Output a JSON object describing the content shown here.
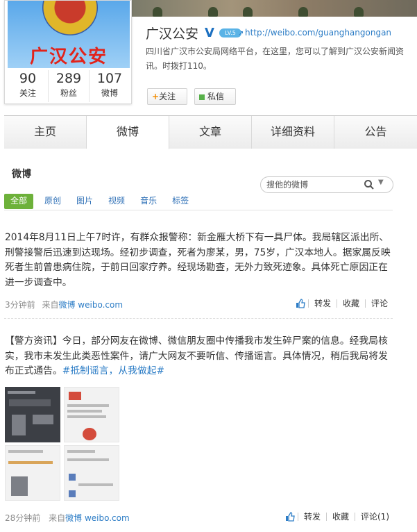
{
  "profile": {
    "avatar_text": "广汉公安",
    "name": "广汉公安",
    "level": "LV.5",
    "url": "http://weibo.com/guanghangongan",
    "description": "四川省广汉市公安局网络平台，在这里，您可以了解到广汉公安新闻资讯。时拨打110。",
    "stats": [
      {
        "num": "90",
        "label": "关注"
      },
      {
        "num": "289",
        "label": "粉丝"
      },
      {
        "num": "107",
        "label": "微博"
      }
    ],
    "follow_label": "关注",
    "message_label": "私信"
  },
  "tabs": [
    "主页",
    "微博",
    "文章",
    "详细资料",
    "公告"
  ],
  "active_tab": 1,
  "feed": {
    "title": "微博",
    "search_placeholder": "搜他的微博",
    "filters": [
      "全部",
      "原创",
      "图片",
      "视频",
      "音乐",
      "标签"
    ]
  },
  "posts": [
    {
      "text": "2014年8月11日上午7时许，有群众报警称：新金雁大桥下有一具尸体。我局辖区派出所、刑警接警后迅速到达现场。经初步调查，死者为廖某，男，75岁，广汉本地人。据家属反映死者生前曾患病住院，于前日回家疗养。经现场勘查，无外力致死迹象。具体死亡原因正在进一步调查中。",
      "time": "3分钟前",
      "source_prefix": "来自",
      "source": "微博 weibo.com",
      "actions": [
        "转发",
        "收藏",
        "评论"
      ]
    },
    {
      "text": "【警方资讯】今日，部分网友在微博、微信朋友圈中传播我市发生碎尸案的信息。经我局核实，我市未发生此类恶性案件，请广大网友不要听信、传播谣言。具体情况，稍后我局将发布正式通告。",
      "hashtag": "#抵制谣言，从我做起#",
      "time": "28分钟前",
      "source_prefix": "来自",
      "source": "微博 weibo.com",
      "actions": [
        "转发",
        "收藏",
        "评论(1)"
      ]
    }
  ],
  "colors": {
    "link": "#2d7dc6",
    "filter_active": "#6db13a",
    "name_red": "#e2231a"
  }
}
